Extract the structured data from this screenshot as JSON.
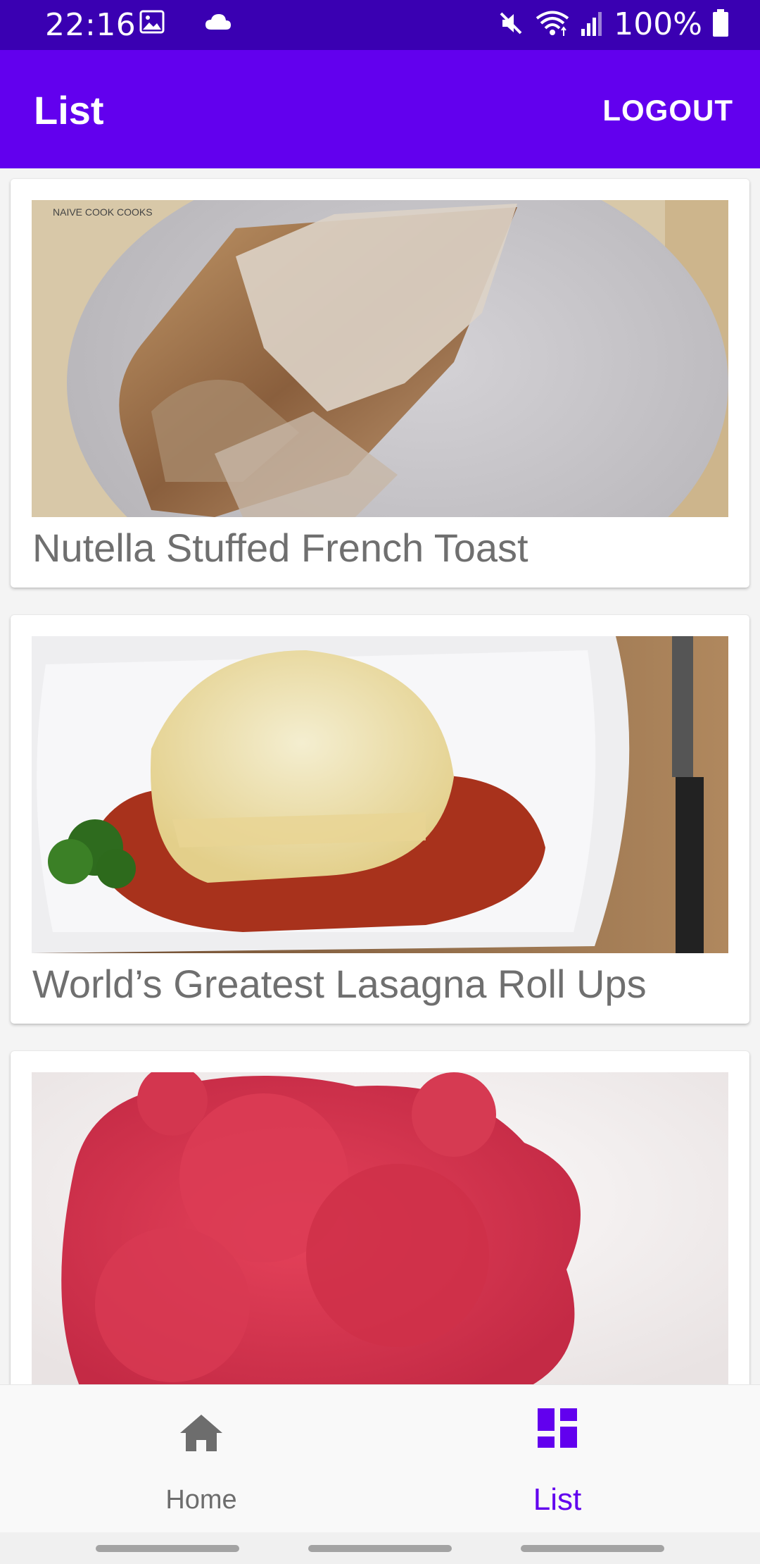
{
  "status_bar": {
    "time": "22:16",
    "battery": "100%",
    "icons": [
      "image-icon",
      "cloud-icon",
      "mute-icon",
      "wifi-icon",
      "signal-icon",
      "battery-icon"
    ]
  },
  "app_bar": {
    "title": "List",
    "logout_label": "LOGOUT",
    "color": "#6200ee"
  },
  "recipes": [
    {
      "title": "Nutella Stuffed French Toast",
      "image_text": "NAIVE COOK COOKS"
    },
    {
      "title": "World’s Greatest Lasagna Roll Ups"
    },
    {
      "title": ""
    }
  ],
  "bottom_nav": {
    "items": [
      {
        "label": "Home",
        "icon": "home-icon",
        "selected": false
      },
      {
        "label": "List",
        "icon": "dashboard-icon",
        "selected": true
      }
    ],
    "accent": "#6200ee"
  }
}
